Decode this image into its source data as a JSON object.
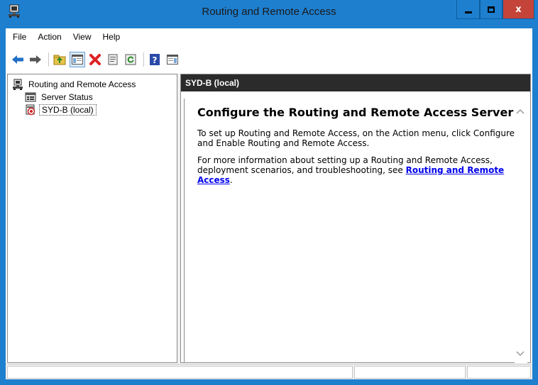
{
  "window": {
    "title": "Routing and Remote Access",
    "accent_color": "#1e7fcf",
    "close_color": "#c5443a",
    "icons": {
      "app": "rras-server-icon",
      "minimize": "minimize-icon",
      "maximize": "maximize-icon",
      "close": "close-icon",
      "close_glyph": "x"
    }
  },
  "menubar": {
    "items": [
      "File",
      "Action",
      "View",
      "Help"
    ]
  },
  "toolbar": {
    "buttons": [
      {
        "name": "back-icon"
      },
      {
        "name": "forward-icon"
      },
      {
        "name": "up-folder-icon"
      },
      {
        "name": "show-hide-tree-icon"
      },
      {
        "name": "delete-icon"
      },
      {
        "name": "properties-icon"
      },
      {
        "name": "refresh-icon"
      },
      {
        "name": "help-icon"
      },
      {
        "name": "show-action-pane-icon"
      }
    ]
  },
  "tree": {
    "root": {
      "label": "Routing and Remote Access",
      "icon": "rras-server-icon"
    },
    "items": [
      {
        "label": "Server Status",
        "icon": "server-status-icon"
      },
      {
        "label": "SYD-B (local)",
        "icon": "server-stopped-icon",
        "selected": true
      }
    ]
  },
  "details": {
    "header": "SYD-B (local)",
    "heading": "Configure the Routing and Remote Access Server",
    "paragraph1": "To set up Routing and Remote Access, on the Action menu, click Configure and Enable Routing and Remote Access.",
    "paragraph2_prefix": "For more information about setting up a Routing and Remote Access, deployment scenarios, and troubleshooting, see ",
    "paragraph2_link": "Routing and Remote Access",
    "paragraph2_suffix": ".",
    "header_bg": "#2b2b2b",
    "link_color": "#0000ee"
  },
  "statusbar": {
    "cells": [
      "",
      "",
      ""
    ]
  }
}
